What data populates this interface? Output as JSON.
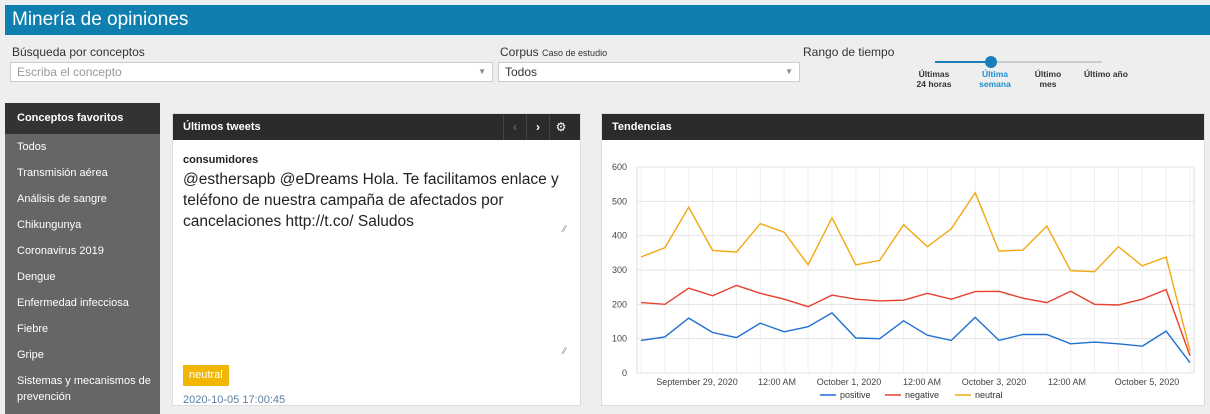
{
  "app": {
    "title": "Minería de opiniones"
  },
  "filters": {
    "concept_label": "Búsqueda por conceptos",
    "concept_placeholder": "Escriba el concepto",
    "corpus_label": "Corpus",
    "corpus_sublabel": "Caso de estudio",
    "corpus_value": "Todos",
    "range_label": "Rango de tiempo",
    "range_options": [
      "Últimas 24 horas",
      "Última semana",
      "Último mes",
      "Último año"
    ],
    "range_selected": "Última semana"
  },
  "sidebar": {
    "title": "Conceptos favoritos",
    "items": [
      "Todos",
      "Transmisión aérea",
      "Análisis de sangre",
      "Chikungunya",
      "Coronavirus 2019",
      "Dengue",
      "Enfermedad infecciosa",
      "Fiebre",
      "Gripe",
      "Sistemas y mecanismos de prevención"
    ]
  },
  "tweets": {
    "title": "Últimos tweets",
    "prev_icon": "chevron-left-icon",
    "next_icon": "chevron-right-icon",
    "settings_icon": "gear-icon",
    "user": "consumidores",
    "text": "@esthersapb @eDreams Hola. Te facilitamos enlace y teléfono de nuestra campaña de afectados por cancelaciones http://t.co/ Saludos",
    "sentiment": "neutral",
    "date": "2020-10-05 17:00:45"
  },
  "trends": {
    "title": "Tendencias"
  },
  "colors": {
    "brand": "#0f7fb0",
    "positive": "#1f6fd1",
    "negative": "#e8412c",
    "neutral": "#f2a811",
    "neutral_badge": "#f2b705"
  },
  "chart_data": {
    "type": "line",
    "title": "",
    "xlabel": "",
    "ylabel": "",
    "ylim": [
      0,
      600
    ],
    "yticks": [
      0,
      100,
      200,
      300,
      400,
      500,
      600
    ],
    "grid": true,
    "legend": "bottom",
    "x_tick_labels": [
      "September 29, 2020",
      "12:00 AM",
      "October 1, 2020",
      "12:00 AM",
      "October 3, 2020",
      "12:00 AM",
      "October 5, 2020"
    ],
    "series": [
      {
        "name": "positive",
        "values": [
          95,
          105,
          160,
          118,
          103,
          145,
          120,
          135,
          175,
          102,
          100,
          152,
          110,
          95,
          162,
          95,
          112,
          112,
          85,
          90,
          85,
          78,
          122,
          30
        ]
      },
      {
        "name": "negative",
        "values": [
          205,
          200,
          247,
          225,
          255,
          232,
          215,
          193,
          227,
          215,
          210,
          212,
          232,
          215,
          237,
          238,
          218,
          205,
          238,
          200,
          198,
          215,
          243,
          50
        ]
      },
      {
        "name": "neutral",
        "values": [
          338,
          365,
          483,
          357,
          352,
          435,
          410,
          315,
          452,
          315,
          328,
          432,
          368,
          420,
          525,
          355,
          358,
          428,
          298,
          295,
          368,
          312,
          338,
          65
        ]
      }
    ]
  }
}
